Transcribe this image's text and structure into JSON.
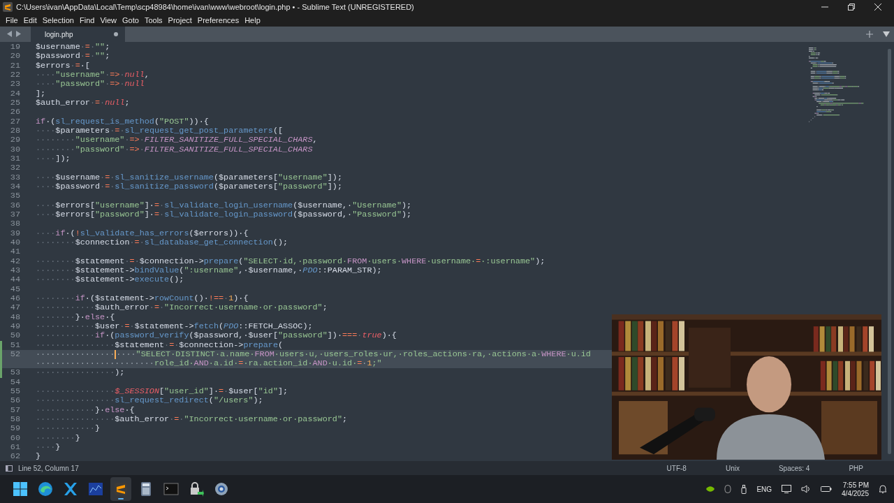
{
  "window": {
    "title": "C:\\Users\\ivan\\AppData\\Local\\Temp\\scp48984\\home\\ivan\\www\\webroot\\login.php • - Sublime Text (UNREGISTERED)"
  },
  "menu": [
    "File",
    "Edit",
    "Selection",
    "Find",
    "View",
    "Goto",
    "Tools",
    "Project",
    "Preferences",
    "Help"
  ],
  "tabs": [
    {
      "label": "login.php",
      "selected": true,
      "dirty": true
    }
  ],
  "editor": {
    "lines": [
      {
        "num": "19",
        "tokens": [
          {
            "kind": "var",
            "text": "$username"
          },
          {
            "kind": "ws",
            "text": "·"
          },
          {
            "kind": "op",
            "text": "="
          },
          {
            "kind": "ws",
            "text": "·"
          },
          {
            "kind": "str",
            "text": "\"\""
          },
          {
            "kind": "punc",
            "text": ";"
          }
        ]
      },
      {
        "num": "20",
        "tokens": [
          {
            "kind": "var",
            "text": "$password"
          },
          {
            "kind": "ws",
            "text": "·"
          },
          {
            "kind": "op",
            "text": "="
          },
          {
            "kind": "ws",
            "text": "·"
          },
          {
            "kind": "str",
            "text": "\"\""
          },
          {
            "kind": "punc",
            "text": ";"
          }
        ]
      },
      {
        "num": "21",
        "tokens": [
          {
            "kind": "var",
            "text": "$errors"
          },
          {
            "kind": "ws",
            "text": "·"
          },
          {
            "kind": "op",
            "text": "="
          },
          {
            "kind": "punc",
            "text": "·["
          }
        ]
      },
      {
        "num": "22",
        "tokens": [
          {
            "kind": "ws",
            "text": "····"
          },
          {
            "kind": "str",
            "text": "\"username\""
          },
          {
            "kind": "ws",
            "text": "·"
          },
          {
            "kind": "op",
            "text": "=>"
          },
          {
            "kind": "ws",
            "text": "·"
          },
          {
            "kind": "lit",
            "text": "null"
          },
          {
            "kind": "punc",
            "text": ","
          }
        ]
      },
      {
        "num": "23",
        "tokens": [
          {
            "kind": "ws",
            "text": "····"
          },
          {
            "kind": "str",
            "text": "\"password\""
          },
          {
            "kind": "ws",
            "text": "·"
          },
          {
            "kind": "op",
            "text": "=>"
          },
          {
            "kind": "ws",
            "text": "·"
          },
          {
            "kind": "lit",
            "text": "null"
          }
        ]
      },
      {
        "num": "24",
        "tokens": [
          {
            "kind": "punc",
            "text": "];"
          }
        ]
      },
      {
        "num": "25",
        "tokens": [
          {
            "kind": "var",
            "text": "$auth_error"
          },
          {
            "kind": "ws",
            "text": "·"
          },
          {
            "kind": "op",
            "text": "="
          },
          {
            "kind": "ws",
            "text": "·"
          },
          {
            "kind": "lit",
            "text": "null"
          },
          {
            "kind": "punc",
            "text": ";"
          }
        ]
      },
      {
        "num": "26"
      },
      {
        "num": "27",
        "tokens": [
          {
            "kind": "kw",
            "text": "if"
          },
          {
            "kind": "punc",
            "text": "·("
          },
          {
            "kind": "fn",
            "text": "sl_request_is_method"
          },
          {
            "kind": "punc",
            "text": "("
          },
          {
            "kind": "str",
            "text": "\"POST\""
          },
          {
            "kind": "punc",
            "text": "))·{"
          }
        ]
      },
      {
        "num": "28",
        "tokens": [
          {
            "kind": "ws",
            "text": "····"
          },
          {
            "kind": "var",
            "text": "$parameters"
          },
          {
            "kind": "ws",
            "text": "·"
          },
          {
            "kind": "op",
            "text": "="
          },
          {
            "kind": "ws",
            "text": "·"
          },
          {
            "kind": "fn",
            "text": "sl_request_get_post_parameters"
          },
          {
            "kind": "punc",
            "text": "(["
          }
        ]
      },
      {
        "num": "29",
        "tokens": [
          {
            "kind": "ws",
            "text": "········"
          },
          {
            "kind": "str",
            "text": "\"username\""
          },
          {
            "kind": "ws",
            "text": "·"
          },
          {
            "kind": "op",
            "text": "=>"
          },
          {
            "kind": "ws",
            "text": "·"
          },
          {
            "kind": "const",
            "text": "FILTER_SANITIZE_FULL_SPECIAL_CHARS"
          },
          {
            "kind": "punc",
            "text": ","
          }
        ]
      },
      {
        "num": "30",
        "tokens": [
          {
            "kind": "ws",
            "text": "········"
          },
          {
            "kind": "str",
            "text": "\"password\""
          },
          {
            "kind": "ws",
            "text": "·"
          },
          {
            "kind": "op",
            "text": "=>"
          },
          {
            "kind": "ws",
            "text": "·"
          },
          {
            "kind": "const",
            "text": "FILTER_SANITIZE_FULL_SPECIAL_CHARS"
          }
        ]
      },
      {
        "num": "31",
        "tokens": [
          {
            "kind": "ws",
            "text": "····"
          },
          {
            "kind": "punc",
            "text": "]);"
          }
        ]
      },
      {
        "num": "32"
      },
      {
        "num": "33",
        "tokens": [
          {
            "kind": "ws",
            "text": "····"
          },
          {
            "kind": "var",
            "text": "$username"
          },
          {
            "kind": "ws",
            "text": "·"
          },
          {
            "kind": "op",
            "text": "="
          },
          {
            "kind": "ws",
            "text": "·"
          },
          {
            "kind": "fn",
            "text": "sl_sanitize_username"
          },
          {
            "kind": "punc",
            "text": "("
          },
          {
            "kind": "var",
            "text": "$parameters"
          },
          {
            "kind": "punc",
            "text": "["
          },
          {
            "kind": "str",
            "text": "\"username\""
          },
          {
            "kind": "punc",
            "text": "]);"
          }
        ]
      },
      {
        "num": "34",
        "tokens": [
          {
            "kind": "ws",
            "text": "····"
          },
          {
            "kind": "var",
            "text": "$password"
          },
          {
            "kind": "ws",
            "text": "·"
          },
          {
            "kind": "op",
            "text": "="
          },
          {
            "kind": "ws",
            "text": "·"
          },
          {
            "kind": "fn",
            "text": "sl_sanitize_password"
          },
          {
            "kind": "punc",
            "text": "("
          },
          {
            "kind": "var",
            "text": "$parameters"
          },
          {
            "kind": "punc",
            "text": "["
          },
          {
            "kind": "str",
            "text": "\"password\""
          },
          {
            "kind": "punc",
            "text": "]);"
          }
        ]
      },
      {
        "num": "35"
      },
      {
        "num": "36",
        "tokens": [
          {
            "kind": "ws",
            "text": "····"
          },
          {
            "kind": "var",
            "text": "$errors"
          },
          {
            "kind": "punc",
            "text": "["
          },
          {
            "kind": "str",
            "text": "\"username\""
          },
          {
            "kind": "punc",
            "text": "]·"
          },
          {
            "kind": "op",
            "text": "="
          },
          {
            "kind": "ws",
            "text": "·"
          },
          {
            "kind": "fn",
            "text": "sl_validate_login_username"
          },
          {
            "kind": "punc",
            "text": "("
          },
          {
            "kind": "var",
            "text": "$username"
          },
          {
            "kind": "punc",
            "text": ",·"
          },
          {
            "kind": "str",
            "text": "\"Username\""
          },
          {
            "kind": "punc",
            "text": ");"
          }
        ]
      },
      {
        "num": "37",
        "tokens": [
          {
            "kind": "ws",
            "text": "····"
          },
          {
            "kind": "var",
            "text": "$errors"
          },
          {
            "kind": "punc",
            "text": "["
          },
          {
            "kind": "str",
            "text": "\"password\""
          },
          {
            "kind": "punc",
            "text": "]·"
          },
          {
            "kind": "op",
            "text": "="
          },
          {
            "kind": "ws",
            "text": "·"
          },
          {
            "kind": "fn",
            "text": "sl_validate_login_password"
          },
          {
            "kind": "punc",
            "text": "("
          },
          {
            "kind": "var",
            "text": "$password"
          },
          {
            "kind": "punc",
            "text": ",·"
          },
          {
            "kind": "str",
            "text": "\"Password\""
          },
          {
            "kind": "punc",
            "text": ");"
          }
        ]
      },
      {
        "num": "38"
      },
      {
        "num": "39",
        "tokens": [
          {
            "kind": "ws",
            "text": "····"
          },
          {
            "kind": "kw",
            "text": "if"
          },
          {
            "kind": "punc",
            "text": "·("
          },
          {
            "kind": "op",
            "text": "!"
          },
          {
            "kind": "fn",
            "text": "sl_validate_has_errors"
          },
          {
            "kind": "punc",
            "text": "("
          },
          {
            "kind": "var",
            "text": "$errors"
          },
          {
            "kind": "punc",
            "text": "))·{"
          }
        ]
      },
      {
        "num": "40",
        "tokens": [
          {
            "kind": "ws",
            "text": "········"
          },
          {
            "kind": "var",
            "text": "$connection"
          },
          {
            "kind": "ws",
            "text": "·"
          },
          {
            "kind": "op",
            "text": "="
          },
          {
            "kind": "ws",
            "text": "·"
          },
          {
            "kind": "fn",
            "text": "sl_database_get_connection"
          },
          {
            "kind": "punc",
            "text": "();"
          }
        ]
      },
      {
        "num": "41"
      },
      {
        "num": "42",
        "tokens": [
          {
            "kind": "ws",
            "text": "········"
          },
          {
            "kind": "var",
            "text": "$statement"
          },
          {
            "kind": "ws",
            "text": "·"
          },
          {
            "kind": "op",
            "text": "="
          },
          {
            "kind": "ws",
            "text": "·"
          },
          {
            "kind": "var",
            "text": "$connection"
          },
          {
            "kind": "punc",
            "text": "->"
          },
          {
            "kind": "fn",
            "text": "prepare"
          },
          {
            "kind": "punc",
            "text": "("
          },
          {
            "kind": "str",
            "text": "\"SELECT·id,·password·"
          },
          {
            "kind": "kw",
            "text": "FROM"
          },
          {
            "kind": "str",
            "text": "·users·"
          },
          {
            "kind": "kw",
            "text": "WHERE"
          },
          {
            "kind": "str",
            "text": "·username·"
          },
          {
            "kind": "op",
            "text": "="
          },
          {
            "kind": "str",
            "text": "·:username\""
          },
          {
            "kind": "punc",
            "text": ");"
          }
        ]
      },
      {
        "num": "43",
        "tokens": [
          {
            "kind": "ws",
            "text": "········"
          },
          {
            "kind": "var",
            "text": "$statement"
          },
          {
            "kind": "punc",
            "text": "->"
          },
          {
            "kind": "fn",
            "text": "bindValue"
          },
          {
            "kind": "punc",
            "text": "("
          },
          {
            "kind": "str",
            "text": "\":username\""
          },
          {
            "kind": "punc",
            "text": ",·"
          },
          {
            "kind": "var",
            "text": "$username"
          },
          {
            "kind": "punc",
            "text": ",·"
          },
          {
            "kind": "cls",
            "text": "PDO"
          },
          {
            "kind": "punc",
            "text": "::PARAM_STR);"
          }
        ]
      },
      {
        "num": "44",
        "tokens": [
          {
            "kind": "ws",
            "text": "········"
          },
          {
            "kind": "var",
            "text": "$statement"
          },
          {
            "kind": "punc",
            "text": "->"
          },
          {
            "kind": "fn",
            "text": "execute"
          },
          {
            "kind": "punc",
            "text": "();"
          }
        ]
      },
      {
        "num": "45"
      },
      {
        "num": "46",
        "tokens": [
          {
            "kind": "ws",
            "text": "········"
          },
          {
            "kind": "kw",
            "text": "if"
          },
          {
            "kind": "punc",
            "text": "·("
          },
          {
            "kind": "var",
            "text": "$statement"
          },
          {
            "kind": "punc",
            "text": "->"
          },
          {
            "kind": "fn",
            "text": "rowCount"
          },
          {
            "kind": "punc",
            "text": "()·"
          },
          {
            "kind": "op",
            "text": "!=="
          },
          {
            "kind": "ws",
            "text": "·"
          },
          {
            "kind": "num",
            "text": "1"
          },
          {
            "kind": "punc",
            "text": ")·{"
          }
        ]
      },
      {
        "num": "47",
        "tokens": [
          {
            "kind": "ws",
            "text": "············"
          },
          {
            "kind": "var",
            "text": "$auth_error"
          },
          {
            "kind": "ws",
            "text": "·"
          },
          {
            "kind": "op",
            "text": "="
          },
          {
            "kind": "ws",
            "text": "·"
          },
          {
            "kind": "str",
            "text": "\"Incorrect·username·or·password\""
          },
          {
            "kind": "punc",
            "text": ";"
          }
        ]
      },
      {
        "num": "48",
        "tokens": [
          {
            "kind": "ws",
            "text": "········"
          },
          {
            "kind": "punc",
            "text": "}·"
          },
          {
            "kind": "kw",
            "text": "else"
          },
          {
            "kind": "punc",
            "text": "·{"
          }
        ]
      },
      {
        "num": "49",
        "tokens": [
          {
            "kind": "ws",
            "text": "············"
          },
          {
            "kind": "var",
            "text": "$user"
          },
          {
            "kind": "ws",
            "text": "·"
          },
          {
            "kind": "op",
            "text": "="
          },
          {
            "kind": "ws",
            "text": "·"
          },
          {
            "kind": "var",
            "text": "$statement"
          },
          {
            "kind": "punc",
            "text": "->"
          },
          {
            "kind": "fn",
            "text": "fetch"
          },
          {
            "kind": "punc",
            "text": "("
          },
          {
            "kind": "cls",
            "text": "PDO"
          },
          {
            "kind": "punc",
            "text": "::FETCH_ASSOC);"
          }
        ]
      },
      {
        "num": "50",
        "tokens": [
          {
            "kind": "ws",
            "text": "············"
          },
          {
            "kind": "kw",
            "text": "if"
          },
          {
            "kind": "punc",
            "text": "·("
          },
          {
            "kind": "fn",
            "text": "password_verify"
          },
          {
            "kind": "punc",
            "text": "("
          },
          {
            "kind": "var",
            "text": "$password"
          },
          {
            "kind": "punc",
            "text": ",·"
          },
          {
            "kind": "var",
            "text": "$user"
          },
          {
            "kind": "punc",
            "text": "["
          },
          {
            "kind": "str",
            "text": "\"password\""
          },
          {
            "kind": "punc",
            "text": "])·"
          },
          {
            "kind": "op",
            "text": "==="
          },
          {
            "kind": "ws",
            "text": "·"
          },
          {
            "kind": "lit",
            "text": "true"
          },
          {
            "kind": "punc",
            "text": ")·{"
          }
        ]
      },
      {
        "num": "51",
        "modified": true,
        "tokens": [
          {
            "kind": "ws",
            "text": "················"
          },
          {
            "kind": "var",
            "text": "$statement"
          },
          {
            "kind": "ws",
            "text": "·"
          },
          {
            "kind": "op",
            "text": "="
          },
          {
            "kind": "ws",
            "text": "·"
          },
          {
            "kind": "var",
            "text": "$connection"
          },
          {
            "kind": "punc",
            "text": "->"
          },
          {
            "kind": "fn",
            "text": "prepare"
          },
          {
            "kind": "punc",
            "text": "("
          }
        ]
      },
      {
        "num": "52",
        "modified": true,
        "current": true,
        "tokens": [
          {
            "kind": "ws",
            "text": "················"
          },
          {
            "kind": "ws",
            "text": "····"
          },
          {
            "kind": "str",
            "text": "\"SELECT·DISTINCT·a.name·"
          },
          {
            "kind": "kw",
            "text": "FROM"
          },
          {
            "kind": "str",
            "text": "·users·u,·users_roles·ur,·roles_actions·ra,·actions·a·"
          },
          {
            "kind": "kw",
            "text": "WHERE"
          },
          {
            "kind": "str",
            "text": "·u.id"
          }
        ]
      },
      {
        "modified": true,
        "current": true,
        "tokens": [
          {
            "kind": "ws",
            "text": "························"
          },
          {
            "kind": "str",
            "text": "role_id·"
          },
          {
            "kind": "kw",
            "text": "AND"
          },
          {
            "kind": "str",
            "text": "·a.id·"
          },
          {
            "kind": "op",
            "text": "="
          },
          {
            "kind": "str",
            "text": "·ra.action_id·"
          },
          {
            "kind": "kw",
            "text": "AND"
          },
          {
            "kind": "str",
            "text": "·u.id·"
          },
          {
            "kind": "op",
            "text": "="
          },
          {
            "kind": "ws",
            "text": "·"
          },
          {
            "kind": "num",
            "text": "1"
          },
          {
            "kind": "str",
            "text": ";\""
          }
        ]
      },
      {
        "num": "53",
        "modified": true,
        "tokens": [
          {
            "kind": "ws",
            "text": "················"
          },
          {
            "kind": "punc",
            "text": ");"
          }
        ]
      },
      {
        "num": "54"
      },
      {
        "num": "55",
        "tokens": [
          {
            "kind": "ws",
            "text": "················"
          },
          {
            "kind": "lit",
            "text": "$_SESSION"
          },
          {
            "kind": "punc",
            "text": "["
          },
          {
            "kind": "str",
            "text": "\"user_id\""
          },
          {
            "kind": "punc",
            "text": "]·"
          },
          {
            "kind": "op",
            "text": "="
          },
          {
            "kind": "ws",
            "text": "·"
          },
          {
            "kind": "var",
            "text": "$user"
          },
          {
            "kind": "punc",
            "text": "["
          },
          {
            "kind": "str",
            "text": "\"id\""
          },
          {
            "kind": "punc",
            "text": "];"
          }
        ]
      },
      {
        "num": "56",
        "tokens": [
          {
            "kind": "ws",
            "text": "················"
          },
          {
            "kind": "fn",
            "text": "sl_request_redirect"
          },
          {
            "kind": "punc",
            "text": "("
          },
          {
            "kind": "str",
            "text": "\"/users\""
          },
          {
            "kind": "punc",
            "text": ");"
          }
        ]
      },
      {
        "num": "57",
        "tokens": [
          {
            "kind": "ws",
            "text": "············"
          },
          {
            "kind": "punc",
            "text": "}·"
          },
          {
            "kind": "kw",
            "text": "else"
          },
          {
            "kind": "punc",
            "text": "·{"
          }
        ]
      },
      {
        "num": "58",
        "tokens": [
          {
            "kind": "ws",
            "text": "················"
          },
          {
            "kind": "var",
            "text": "$auth_error"
          },
          {
            "kind": "ws",
            "text": "·"
          },
          {
            "kind": "op",
            "text": "="
          },
          {
            "kind": "ws",
            "text": "·"
          },
          {
            "kind": "str",
            "text": "\"Incorrect·username·or·password\""
          },
          {
            "kind": "punc",
            "text": ";"
          }
        ]
      },
      {
        "num": "59",
        "tokens": [
          {
            "kind": "ws",
            "text": "············"
          },
          {
            "kind": "punc",
            "text": "}"
          }
        ]
      },
      {
        "num": "60",
        "tokens": [
          {
            "kind": "ws",
            "text": "········"
          },
          {
            "kind": "punc",
            "text": "}"
          }
        ]
      },
      {
        "num": "61",
        "tokens": [
          {
            "kind": "ws",
            "text": "····"
          },
          {
            "kind": "punc",
            "text": "}"
          }
        ]
      },
      {
        "num": "62",
        "tokens": [
          {
            "kind": "punc",
            "text": "}"
          }
        ]
      }
    ]
  },
  "status_bar": {
    "position": "Line 52, Column 17",
    "right": [
      "UTF-8",
      "Unix",
      "Spaces: 4",
      "PHP"
    ]
  },
  "taskbar": {
    "apps": [
      {
        "kind": "start",
        "selected": false
      },
      {
        "kind": "browser",
        "selected": false
      },
      {
        "kind": "xapp",
        "selected": false
      },
      {
        "kind": "chart",
        "selected": false
      },
      {
        "kind": "sublime",
        "selected": true
      },
      {
        "kind": "calculator",
        "selected": false
      },
      {
        "kind": "terminal",
        "selected": false
      },
      {
        "kind": "lock",
        "selected": false
      },
      {
        "kind": "gear",
        "selected": false
      }
    ],
    "language": "ENG",
    "time": "7:55 PM",
    "date": "4/4/2025"
  },
  "webcam": {
    "kind": "picture"
  }
}
